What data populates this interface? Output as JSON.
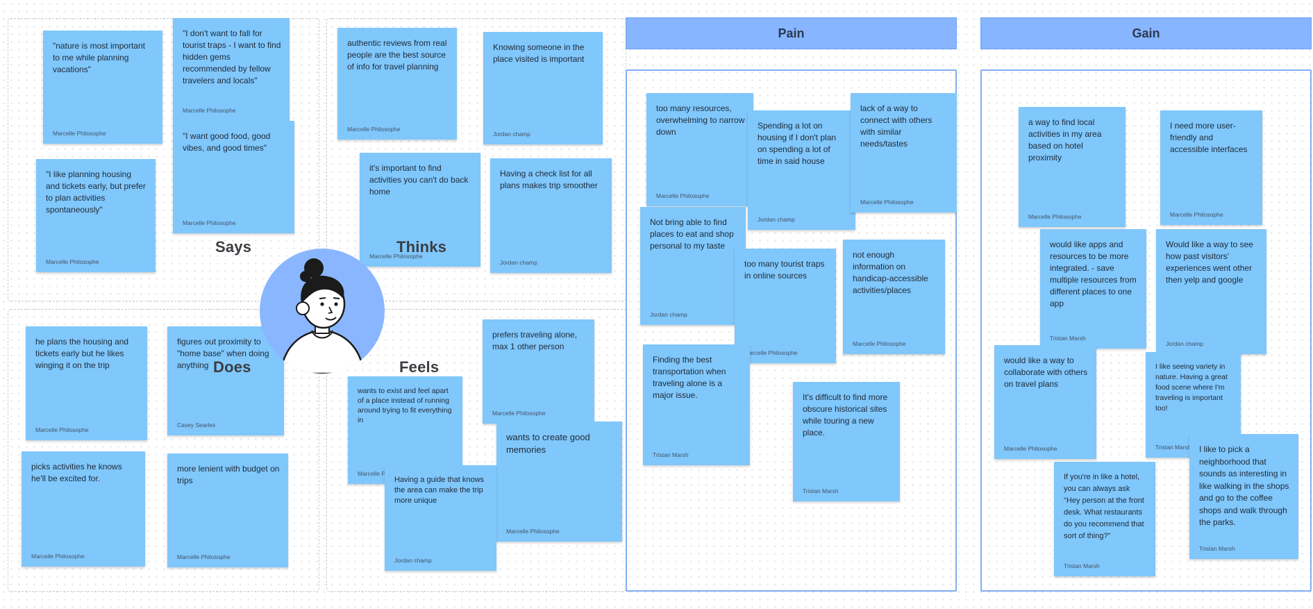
{
  "quadrants": {
    "says": "Says",
    "thinks": "Thinks",
    "does": "Does",
    "feels": "Feels"
  },
  "headers": {
    "pain": "Pain",
    "gain": "Gain"
  },
  "colors": {
    "note": "#80c7fc",
    "header": "#87b5ff",
    "panel_border": "#82aef3"
  },
  "says": [
    {
      "text": "\"nature is most important to me while planning vacations\"",
      "author": "Marcelle Philosophe"
    },
    {
      "text": "\"I don't want to fall for tourist traps - I want to find hidden gems recommended by fellow travelers and locals\"",
      "author": "Marcelle Philosophe"
    },
    {
      "text": "\"I want good food, good vibes, and good times\"",
      "author": "Marcelle Philosophe"
    },
    {
      "text": "\"I like planning housing and tickets early, but prefer to plan activities spontaneously\"",
      "author": "Marcelle Philosophe"
    }
  ],
  "thinks": [
    {
      "text": "authentic reviews from real people are the best source of info for travel planning",
      "author": "Marcelle Philosophe"
    },
    {
      "text": "Knowing someone in the place visited is important",
      "author": "Jordan champ"
    },
    {
      "text": "it's important to find activities you can't do back home",
      "author": "Marcelle Philosophe"
    },
    {
      "text": "Having a check list for all plans makes trip smoother",
      "author": "Jordan champ"
    }
  ],
  "does": [
    {
      "text": "he plans the housing and tickets early but he likes winging it on the trip",
      "author": "Marcelle Philosophe"
    },
    {
      "text": "figures out proximity to \"home base\" when doing anything",
      "author": "Casey Searles"
    },
    {
      "text": "picks activities he knows he'll be excited for.",
      "author": "Marcelle Philosophe"
    },
    {
      "text": "more lenient with budget on trips",
      "author": "Marcelle Philosophe"
    }
  ],
  "feels": [
    {
      "text": "prefers traveling alone, max 1 other person",
      "author": "Marcelle Philosophe"
    },
    {
      "text": "wants to exist and feel apart of a place instead of running around trying to fit everything in",
      "author": "Marcelle P"
    },
    {
      "text": "wants to create good memories",
      "author": "Marcelle Philosophe"
    },
    {
      "text": "Having a guide that knows the area can make the trip more unique",
      "author": "Jordan champ"
    }
  ],
  "pain": [
    {
      "text": "too many resources, overwhelming to narrow down",
      "author": "Marcelle Philosophe"
    },
    {
      "text": "Spending a lot on housing if I don't plan on spending a lot of time in said house",
      "author": "Jordan champ"
    },
    {
      "text": "lack of a way to connect with others with similar needs/tastes",
      "author": "Marcelle Philosophe"
    },
    {
      "text": "Not bring able to find places to eat and shop personal to my taste",
      "author": "Jordan champ"
    },
    {
      "text": "too many tourist traps in online sources",
      "author": "Marcelle Philosophe"
    },
    {
      "text": "not enough information on handicap-accessible activities/places",
      "author": "Marcelle Philosophe"
    },
    {
      "text": "Finding the best transportation when traveling alone is a major issue.",
      "author": "Tristan Marsh"
    },
    {
      "text": "It's difficult to find more obscure historical sites while touring a new place.",
      "author": "Tristan Marsh"
    }
  ],
  "gain": [
    {
      "text": "a way to find local activities in my area based on hotel proximity",
      "author": "Marcelle Philosophe"
    },
    {
      "text": "I need more user-friendly and accessible interfaces",
      "author": "Marcelle Philosophe"
    },
    {
      "text": "would like apps and resources to be more integrated. - save multiple resources from different places to one app",
      "author": "Tristan Marsh"
    },
    {
      "text": "Would like a way to see how past visitors' experiences went other then yelp and google",
      "author": "Jordan champ"
    },
    {
      "text": "would like a way to collaborate with others on travel plans",
      "author": "Marcelle Philosophe"
    },
    {
      "text": "I like seeing variety in nature.  Having a great food scene where I'm traveling is important too!",
      "author": "Tristan Marsh"
    },
    {
      "text": "If you're in like a hotel, you can always ask \"Hey person at the front desk. What restaurants do you recommend that sort of thing?\"",
      "author": "Tristan Marsh"
    },
    {
      "text": "I like to pick a neighborhood that sounds as interesting in like walking in the shops and go to the coffee shops and walk through the parks.",
      "author": "Tristan Marsh"
    }
  ]
}
